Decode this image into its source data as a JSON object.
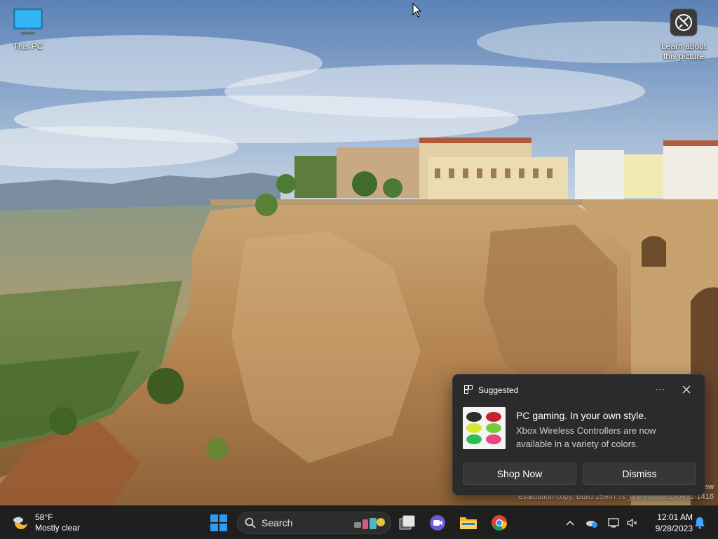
{
  "desktop": {
    "icons": [
      {
        "label": "This PC",
        "icon": "monitor-icon"
      },
      {
        "label_line1": "Learn about",
        "label_line2": "this picture",
        "icon": "camera-icon"
      }
    ],
    "watermark_line1": "ew",
    "watermark_line2": "Evaluation copy. Build 25947.rs_prerelease.230901-1416"
  },
  "toast": {
    "header": "Suggested",
    "more_label": "···",
    "title": "PC gaming. In your own style.",
    "body": "Xbox Wireless Controllers are now available in a variety of colors.",
    "primary_button": "Shop Now",
    "secondary_button": "Dismiss"
  },
  "taskbar": {
    "weather": {
      "temperature": "58°F",
      "condition": "Mostly clear"
    },
    "search_placeholder": "Search",
    "pinned_apps": [
      "start-button",
      "search-box",
      "task-view",
      "teams-chat",
      "file-explorer",
      "chrome"
    ],
    "clock": {
      "time": "12:01 AM",
      "date": "9/28/2023"
    }
  },
  "colors": {
    "taskbar_bg": "#1f1f1f",
    "toast_bg": "#2b2b2b",
    "start_blue": "#2f9bf0",
    "accent": "#0078d4"
  }
}
